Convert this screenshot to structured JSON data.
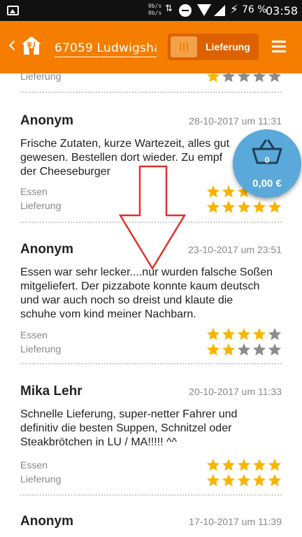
{
  "status_bar": {
    "net_speed_up": "0b/s",
    "net_speed_down": "0b/s",
    "battery": "76 %",
    "time": "03:58"
  },
  "app_bar": {
    "address": "67059 Ludwigsha...",
    "mode_label": "Lieferung",
    "back_icon": "chevron-left-icon",
    "menu_icon": "hamburger-menu-icon"
  },
  "colors": {
    "brand": "#f57d00",
    "cart": "#5aa9da",
    "star_filled": "#f7b500",
    "star_empty": "#8c8c8c"
  },
  "partial_top": {
    "label": "Lieferung",
    "rating": 1
  },
  "reviews": [
    {
      "name": "Anonym",
      "date": "28-10-2017 um 11:31",
      "text_lines": [
        "Frische Zutaten, kurze Wartezeit, alles gut",
        "gewesen. Bestellen dort wieder. Zu empf",
        "der Cheeseburger"
      ],
      "food_label": "Essen",
      "delivery_label": "Lieferung",
      "food_rating": 5,
      "delivery_rating": 5
    },
    {
      "name": "Anonym",
      "date": "23-10-2017 um 23:51",
      "text_lines": [
        "Essen war sehr lecker....nur wurden falsche Soßen",
        "mitgeliefert. Der pizzabote konnte kaum deutsch",
        "und war auch noch so dreist und klaute die",
        "schuhe vom kind meiner Nachbarn."
      ],
      "food_label": "Essen",
      "delivery_label": "Lieferung",
      "food_rating": 4,
      "delivery_rating": 2
    },
    {
      "name": "Mika Lehr",
      "date": "20-10-2017 um 11:33",
      "text_lines": [
        "Schnelle Lieferung, super-netter Fahrer und",
        "definitiv die besten Suppen, Schnitzel oder",
        "Steakbrötchen in LU / MA!!!!! ^^"
      ],
      "food_label": "Essen",
      "delivery_label": "Lieferung",
      "food_rating": 5,
      "delivery_rating": 5
    },
    {
      "name": "Anonym",
      "date": "17-10-2017 um 11:39"
    }
  ],
  "cart": {
    "count": "0",
    "total": "0,00 €",
    "icon": "basket-icon"
  }
}
